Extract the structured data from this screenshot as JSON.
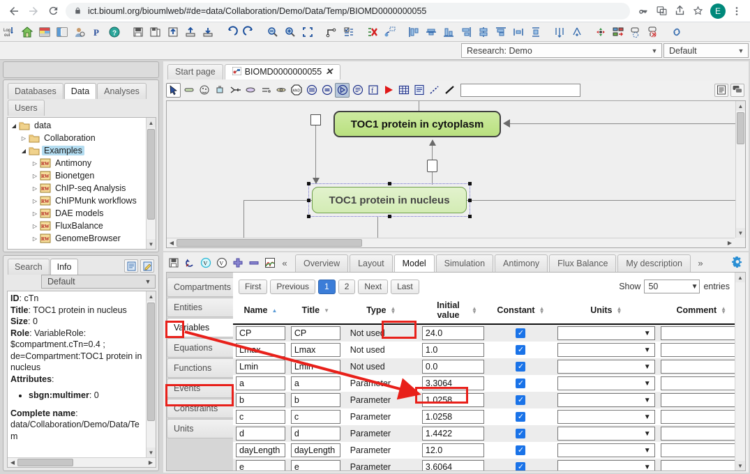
{
  "browser": {
    "back_icon": "back-arrow-icon",
    "forward_icon": "forward-arrow-icon",
    "reload_icon": "reload-icon",
    "lock_icon": "lock-icon",
    "url": "ict.biouml.org/bioumlweb/#de=data/Collaboration/Demo/Data/Temp/BIOMD0000000055",
    "key_icon": "password-key-icon",
    "translate_icon": "translate-icon",
    "share_icon": "share-icon",
    "star_icon": "bookmark-star-icon",
    "avatar_letter": "E",
    "menu_icon": "three-dot-menu-icon"
  },
  "app_toolbar": {
    "buttons": [
      {
        "name": "logout-button",
        "icon": "logout-icon"
      },
      {
        "name": "home-button",
        "icon": "home-icon"
      },
      {
        "name": "perspective-button",
        "icon": "layout-horizontal-icon"
      },
      {
        "name": "layout-vertical-button",
        "icon": "layout-vertical-icon"
      },
      {
        "name": "user-button",
        "icon": "user-icon"
      },
      {
        "name": "preferences-button",
        "icon": "letter-p-icon"
      },
      {
        "name": "help-button",
        "icon": "help-question-icon"
      },
      {
        "name": "save-button",
        "icon": "floppy-disk-icon"
      },
      {
        "name": "save-as-button",
        "icon": "save-as-icon"
      },
      {
        "name": "import-button",
        "icon": "import-icon"
      },
      {
        "name": "upload-button",
        "icon": "upload-icon"
      },
      {
        "name": "download-button",
        "icon": "download-icon"
      },
      {
        "name": "undo-button",
        "icon": "undo-arrow-icon"
      },
      {
        "name": "redo-button",
        "icon": "redo-arrow-icon"
      },
      {
        "name": "zoom-out-button",
        "icon": "zoom-out-icon"
      },
      {
        "name": "zoom-in-button",
        "icon": "zoom-in-icon"
      },
      {
        "name": "fit-to-screen-button",
        "icon": "fit-screen-icon"
      },
      {
        "name": "edge-style-button",
        "icon": "edge-route-icon"
      },
      {
        "name": "properties-button",
        "icon": "properties-list-icon"
      },
      {
        "name": "remove-layout-button",
        "icon": "remove-layout-icon"
      },
      {
        "name": "apply-layout-button",
        "icon": "apply-layout-icon"
      },
      {
        "name": "align-left-button",
        "icon": "align-left-icon"
      },
      {
        "name": "align-center-h-button",
        "icon": "align-center-horizontal-icon"
      },
      {
        "name": "align-bottom-button",
        "icon": "align-bottom-icon"
      },
      {
        "name": "align-right-button",
        "icon": "align-right-icon"
      },
      {
        "name": "align-middle-button",
        "icon": "align-middle-icon"
      },
      {
        "name": "align-top-button",
        "icon": "align-top-icon"
      },
      {
        "name": "distribute-h-button",
        "icon": "distribute-horizontal-icon"
      },
      {
        "name": "distribute-v-button",
        "icon": "distribute-vertical-icon"
      },
      {
        "name": "merge-nodes-button",
        "icon": "merge-nodes-icon"
      },
      {
        "name": "split-nodes-button",
        "icon": "split-nodes-icon"
      },
      {
        "name": "node-color-button",
        "icon": "node-color-icon"
      },
      {
        "name": "node-style-button",
        "icon": "node-style-icon"
      },
      {
        "name": "add-note-button",
        "icon": "add-note-icon"
      },
      {
        "name": "remove-text-button",
        "icon": "remove-text-icon"
      },
      {
        "name": "link-button",
        "icon": "link-icon"
      }
    ]
  },
  "selectors": {
    "research": "Research: Demo",
    "default": "Default"
  },
  "repository": {
    "tabs": [
      {
        "label": "Databases",
        "active": false
      },
      {
        "label": "Data",
        "active": true
      },
      {
        "label": "Analyses",
        "active": false
      },
      {
        "label": "Users",
        "active": false
      }
    ],
    "tree": [
      {
        "label": "data",
        "depth": 0,
        "expander": "expanded",
        "icon": "folder-icon",
        "selected": false
      },
      {
        "label": "Collaboration",
        "depth": 1,
        "expander": "collapsed",
        "icon": "folder-icon",
        "selected": false
      },
      {
        "label": "Examples",
        "depth": 1,
        "expander": "expanded",
        "icon": "folder-icon",
        "selected": true
      },
      {
        "label": "Antimony",
        "depth": 2,
        "expander": "collapsed",
        "icon": "rw-repository-icon",
        "selected": false
      },
      {
        "label": "Bionetgen",
        "depth": 2,
        "expander": "collapsed",
        "icon": "rw-repository-icon",
        "selected": false
      },
      {
        "label": "ChIP-seq Analysis",
        "depth": 2,
        "expander": "collapsed",
        "icon": "rw-repository-icon",
        "selected": false
      },
      {
        "label": "ChIPMunk workflows",
        "depth": 2,
        "expander": "collapsed",
        "icon": "rw-repository-icon",
        "selected": false
      },
      {
        "label": "DAE models",
        "depth": 2,
        "expander": "collapsed",
        "icon": "rw-repository-icon",
        "selected": false
      },
      {
        "label": "FluxBalance",
        "depth": 2,
        "expander": "collapsed",
        "icon": "rw-repository-icon",
        "selected": false
      },
      {
        "label": "GenomeBrowser",
        "depth": 2,
        "expander": "collapsed",
        "icon": "rw-repository-icon",
        "selected": false
      }
    ]
  },
  "info_panel": {
    "tabs": [
      {
        "label": "Search",
        "active": false
      },
      {
        "label": "Info",
        "active": true
      }
    ],
    "view_icon": "document-view-icon",
    "edit_icon": "edit-pencil-icon",
    "combo_value": "Default",
    "fields": {
      "id_label": "ID",
      "id_value": "cTn",
      "title_label": "Title",
      "title_value": "TOC1 protein in nucleus",
      "size_label": "Size",
      "size_value": "0",
      "role_label": "Role",
      "role_value": "VariableRole: $compartment.cTn=0.4 ; de=Compartment:TOC1 protein in nucleus",
      "attributes_label": "Attributes",
      "attribute_item_label": "sbgn:multimer",
      "attribute_item_value": "0",
      "complete_name_label": "Complete name",
      "complete_name_value": "data/Collaboration/Demo/Data/Tem"
    }
  },
  "document": {
    "tabs": [
      {
        "label": "Start page",
        "active": false,
        "icon": null
      },
      {
        "label": "BIOMD0000000055",
        "active": true,
        "icon": "diagram-icon",
        "closable": true
      }
    ],
    "toolbar": [
      {
        "name": "select-tool",
        "icon": "cursor-arrow-icon",
        "state": "selected"
      },
      {
        "name": "compartment-tool",
        "icon": "compartment-icon",
        "state": "normal"
      },
      {
        "name": "cell-tool",
        "icon": "cell-icon",
        "state": "normal"
      },
      {
        "name": "entity-pool-tool",
        "icon": "entity-pool-icon",
        "state": "normal"
      },
      {
        "name": "source-sink-tool",
        "icon": "source-sink-icon",
        "state": "normal"
      },
      {
        "name": "complex-tool",
        "icon": "complex-ellipse-icon",
        "state": "normal"
      },
      {
        "name": "macromolecule-tool",
        "icon": "macromolecule-icon",
        "state": "normal"
      },
      {
        "name": "nucleic-feature-tool",
        "icon": "nucleic-acid-icon",
        "state": "normal"
      },
      {
        "name": "and-gate-tool",
        "icon": "and-logic-icon",
        "state": "normal"
      },
      {
        "name": "equivalence-tool",
        "icon": "equivalence-icon",
        "state": "normal"
      },
      {
        "name": "equation-tool",
        "icon": "equation-icon",
        "state": "normal"
      },
      {
        "name": "function-tool",
        "icon": "function-icon",
        "state": "highlighted"
      },
      {
        "name": "note-tool",
        "icon": "note-icon",
        "state": "normal"
      },
      {
        "name": "table-field-tool",
        "icon": "boxed-f-icon",
        "state": "normal"
      },
      {
        "name": "run-simulation-button",
        "icon": "play-triangle-icon",
        "state": "normal"
      },
      {
        "name": "table-view-button",
        "icon": "grid-table-icon",
        "state": "normal"
      },
      {
        "name": "document-view-button",
        "icon": "document-lines-icon",
        "state": "normal"
      },
      {
        "name": "dashed-edge-tool",
        "icon": "dashed-line-icon",
        "state": "normal"
      },
      {
        "name": "solid-edge-tool",
        "icon": "solid-line-icon",
        "state": "normal"
      }
    ],
    "search_value": "",
    "right_buttons": [
      {
        "name": "list-view-button",
        "icon": "list-lines-icon"
      },
      {
        "name": "comments-button",
        "icon": "comment-bubbles-icon"
      }
    ]
  },
  "diagram": {
    "nodes": [
      {
        "label": "TOC1 protein in cytoplasm",
        "name": "node-toc1-cytoplasm",
        "selected": false
      },
      {
        "label": "TOC1 protein in nucleus",
        "name": "node-toc1-nucleus",
        "selected": true
      }
    ]
  },
  "model_panel": {
    "toolbar": [
      {
        "name": "save-model-button",
        "icon": "floppy-disk-icon",
        "highlighted": true
      },
      {
        "name": "refresh-model-button",
        "icon": "refresh-arrows-icon",
        "highlighted": false
      },
      {
        "name": "variable-show-button",
        "icon": "circled-v-icon",
        "highlighted": false
      },
      {
        "name": "variable-hide-button",
        "icon": "circled-v-outline-icon",
        "highlighted": false
      },
      {
        "name": "add-row-button",
        "icon": "plus-cross-icon",
        "highlighted": false
      },
      {
        "name": "remove-row-button",
        "icon": "minus-bar-icon",
        "highlighted": false
      },
      {
        "name": "plot-button",
        "icon": "plot-chart-icon",
        "highlighted": false
      }
    ],
    "collapse_left_icon": "double-chevron-left-icon",
    "overflow_icon": "double-chevron-right-icon",
    "gear_icon": "gear-icon",
    "tabs": [
      {
        "label": "Overview",
        "active": false
      },
      {
        "label": "Layout",
        "active": false
      },
      {
        "label": "Model",
        "active": true
      },
      {
        "label": "Simulation",
        "active": false
      },
      {
        "label": "Antimony",
        "active": false
      },
      {
        "label": "Flux Balance",
        "active": false
      },
      {
        "label": "My description",
        "active": false
      }
    ],
    "side_tabs": [
      {
        "label": "Compartments",
        "active": false
      },
      {
        "label": "Entities",
        "active": false
      },
      {
        "label": "Variables",
        "active": true
      },
      {
        "label": "Equations",
        "active": false
      },
      {
        "label": "Functions",
        "active": false
      },
      {
        "label": "Events",
        "active": false
      },
      {
        "label": "Constraints",
        "active": false
      },
      {
        "label": "Units",
        "active": false
      }
    ],
    "pager": [
      {
        "label": "First",
        "current": false
      },
      {
        "label": "Previous",
        "current": false
      },
      {
        "label": "1",
        "current": true
      },
      {
        "label": "2",
        "current": false
      },
      {
        "label": "Next",
        "current": false
      },
      {
        "label": "Last",
        "current": false
      }
    ],
    "show_label": "Show",
    "show_value": "50",
    "entries_label": "entries",
    "table": {
      "columns": [
        {
          "label": "Name",
          "sort": "asc"
        },
        {
          "label": "Title",
          "sort": "desc"
        },
        {
          "label": "Type",
          "sort": "none"
        },
        {
          "label": "Initial value",
          "sort": "none"
        },
        {
          "label": "Constant",
          "sort": "none"
        },
        {
          "label": "Units",
          "sort": "none"
        },
        {
          "label": "Comment",
          "sort": "none"
        }
      ],
      "rows": [
        {
          "name": "CP",
          "title": "CP",
          "type": "Not used",
          "initial_value": "24.0",
          "constant": true,
          "units": "",
          "comment": "",
          "highlight_initial": true
        },
        {
          "name": "Lmax",
          "title": "Lmax",
          "type": "Not used",
          "initial_value": "1.0",
          "constant": true,
          "units": "",
          "comment": ""
        },
        {
          "name": "Lmin",
          "title": "Lmin",
          "type": "Not used",
          "initial_value": "0.0",
          "constant": true,
          "units": "",
          "comment": ""
        },
        {
          "name": "a",
          "title": "a",
          "type": "Parameter",
          "initial_value": "3.3064",
          "constant": true,
          "units": "",
          "comment": ""
        },
        {
          "name": "b",
          "title": "b",
          "type": "Parameter",
          "initial_value": "1.0258",
          "constant": true,
          "units": "",
          "comment": ""
        },
        {
          "name": "c",
          "title": "c",
          "type": "Parameter",
          "initial_value": "1.0258",
          "constant": true,
          "units": "",
          "comment": ""
        },
        {
          "name": "d",
          "title": "d",
          "type": "Parameter",
          "initial_value": "1.4422",
          "constant": true,
          "units": "",
          "comment": ""
        },
        {
          "name": "dayLength",
          "title": "dayLength",
          "type": "Parameter",
          "initial_value": "12.0",
          "constant": true,
          "units": "",
          "comment": ""
        },
        {
          "name": "e",
          "title": "e",
          "type": "Parameter",
          "initial_value": "3.6064",
          "constant": true,
          "units": "",
          "comment": ""
        }
      ]
    }
  },
  "annotations": {
    "highlight_color": "#e8201a",
    "boxes": [
      "save-model-button",
      "side-tab-variables",
      "tab-model",
      "initial-value-cp"
    ]
  }
}
